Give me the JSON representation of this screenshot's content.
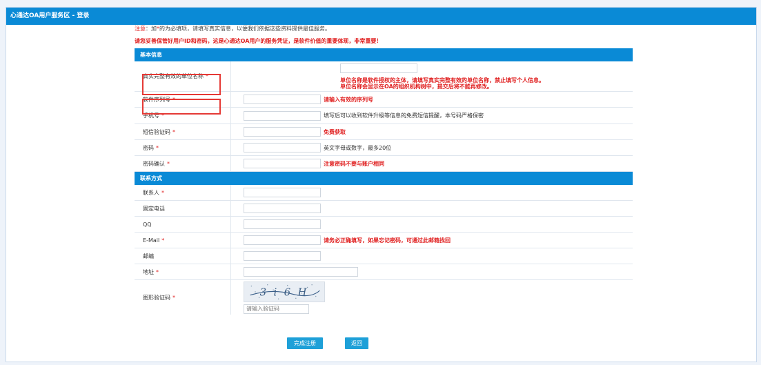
{
  "header": {
    "title": "心通达OA用户服务区 - 登录"
  },
  "notice": {
    "lead": "注意",
    "prefix": "：加",
    "star": "*",
    "rest": "的为必填项，请填写真实信息，以便我们依据这些资料提供最佳服务。",
    "warning": "请您妥善保管好用户ID和密码，这是心通达OA用户的服务凭证，是软件价值的重要体现，非常重要！"
  },
  "basic": {
    "title": "基本信息",
    "unit": {
      "label": "真实完整有效的单位名称",
      "hint1": "单位名称是软件授权的主体，请填写真实完整有效的单位名称，禁止填写个人信息。",
      "hint2": "单位名称会显示在OA的组织机构树中，提交后将不能再修改。"
    },
    "serial": {
      "label": "软件序列号",
      "hint": "请输入有效的序列号"
    },
    "mobile": {
      "label": "手机号",
      "hint": "填写后可以收到软件升级等信息的免费短信提醒，本号码严格保密"
    },
    "sms": {
      "label": "短信验证码",
      "hint": "免费获取"
    },
    "password": {
      "label": "密码",
      "hint": "英文字母或数字，最多20位"
    },
    "confirm": {
      "label": "密码确认",
      "hint": "注意密码不要与账户相同"
    }
  },
  "contact": {
    "title": "联系方式",
    "person": {
      "label": "联系人"
    },
    "phone": {
      "label": "固定电话"
    },
    "qq": {
      "label": "QQ"
    },
    "email": {
      "label": "E-Mail",
      "hint": "请务必正确填写，如果忘记密码，可通过此邮箱找回"
    },
    "zip": {
      "label": "邮编"
    },
    "address": {
      "label": "地址"
    },
    "captcha": {
      "label": "图形验证码",
      "image_text": "3 i 6 H",
      "placeholder": "请输入验证码"
    }
  },
  "required_mark": "*",
  "buttons": {
    "submit": "完成注册",
    "back": "返回"
  },
  "colors": {
    "accent": "#0a8ad6",
    "required": "#e02020",
    "button": "#1ea0d8",
    "highlight": "#e53935"
  }
}
